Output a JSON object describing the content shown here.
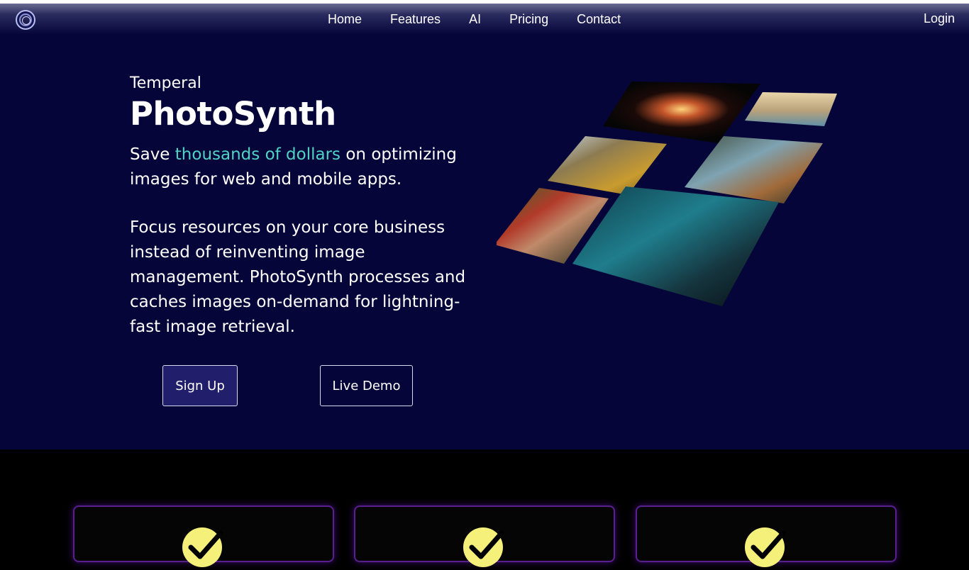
{
  "nav": {
    "logo_icon": "circular-lens-logo-icon",
    "links": [
      "Home",
      "Features",
      "AI",
      "Pricing",
      "Contact"
    ],
    "login": "Login"
  },
  "hero": {
    "eyebrow": "Temperal",
    "title": "PhotoSynth",
    "tagline_prefix": "Save ",
    "tagline_highlight": "thousands of dollars",
    "tagline_suffix": " on optimizing images for web and mobile apps.",
    "description": "Focus resources on your core business instead of reinventing image management. PhotoSynth processes and caches images on-demand for lightning-fast image retrieval.",
    "buttons": {
      "signup": "Sign Up",
      "demo": "Live Demo"
    },
    "mosaic_images": [
      "fireworks-photo",
      "coastal-town-photo",
      "mountain-valley-photo",
      "deer-forest-photo",
      "woman-flowers-photo",
      "night-sky-mountain-photo"
    ]
  },
  "features": {
    "cards": [
      {
        "icon": "check-badge-icon"
      },
      {
        "icon": "check-badge-icon"
      },
      {
        "icon": "check-badge-icon"
      }
    ]
  },
  "colors": {
    "hero_bg": "#05053a",
    "accent_teal": "#4fd3c4",
    "signup_bg": "#211e6b",
    "card_border": "#5a1f8f",
    "check_yellow": "#f5f07a"
  }
}
